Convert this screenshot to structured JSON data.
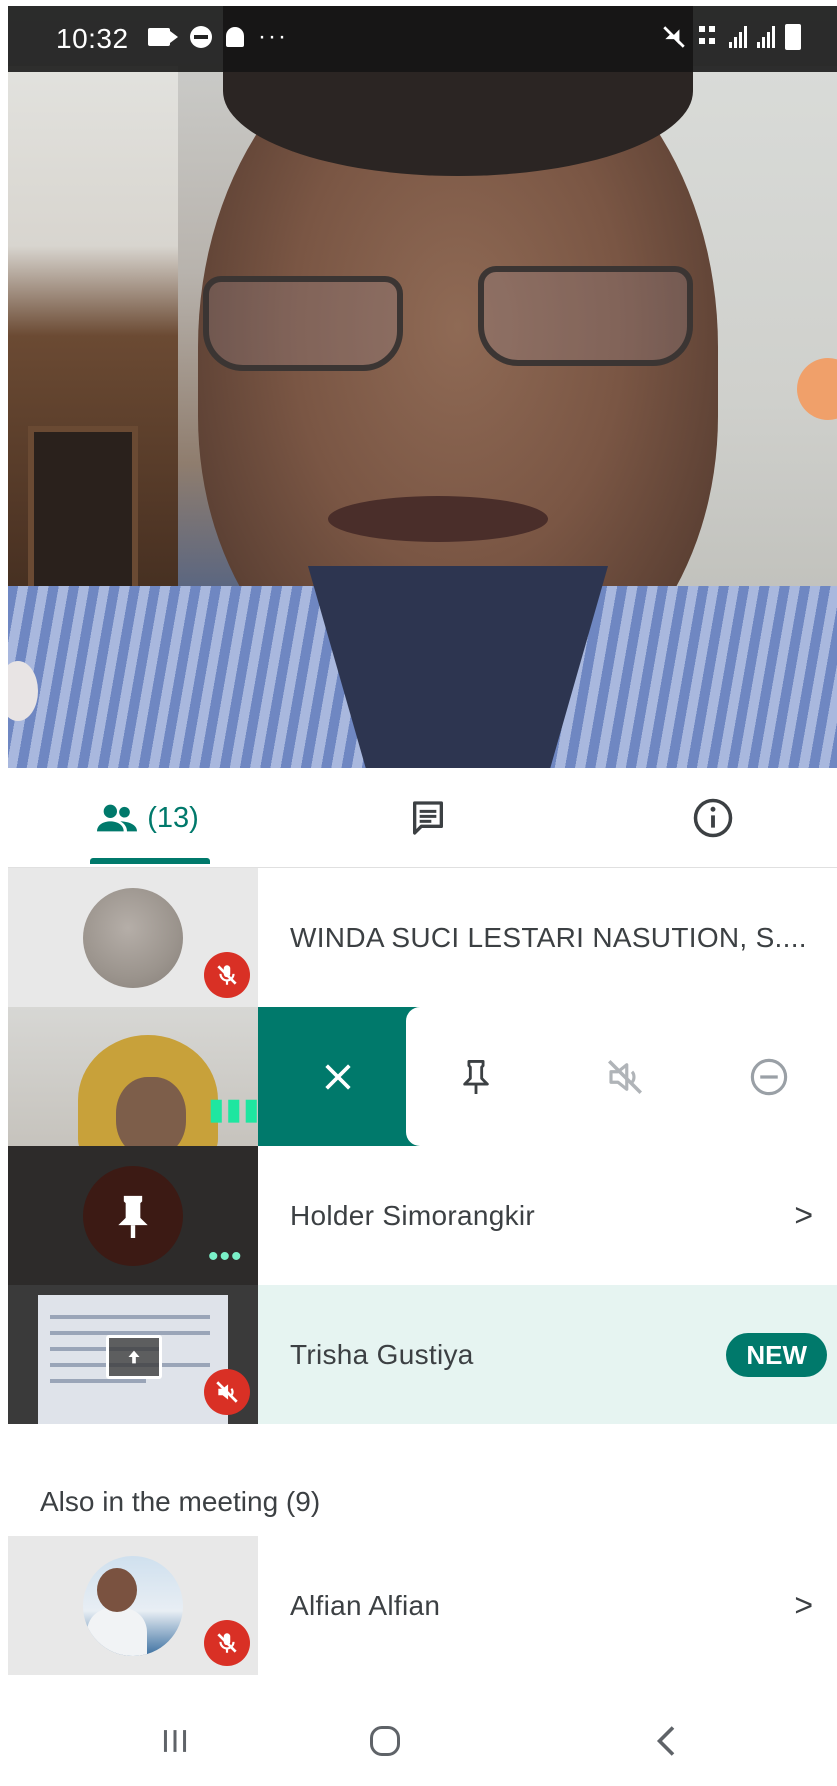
{
  "status_bar": {
    "time": "10:32",
    "left_icons": [
      "video-camera-icon",
      "dnd-icon",
      "notification-bell-icon",
      "more-dots-icon"
    ],
    "right_icons": [
      "mute-vibrate-icon",
      "wifi-calling-icon",
      "signal-sim1-icon",
      "signal-sim2-icon",
      "battery-icon"
    ]
  },
  "tabs": {
    "people": {
      "icon": "people-icon",
      "count": "(13)"
    },
    "chat": {
      "icon": "chat-icon"
    },
    "info": {
      "icon": "info-icon"
    }
  },
  "participants": [
    {
      "name": "WINDA SUCI LESTARI NASUTION, S....",
      "thumb": "grey-avatar",
      "status_icon": "mic-off-icon"
    },
    {
      "name": "",
      "thumb": "video",
      "status_icon": "audio-level-dots",
      "actions": [
        "close-icon",
        "pin-icon",
        "mute-icon",
        "remove-icon"
      ]
    },
    {
      "name": "Holder Simorangkir",
      "thumb": "pin-circle",
      "status_icon": "audio-level-dots",
      "chevron": ">"
    },
    {
      "name": "Trisha Gustiya",
      "thumb": "presentation",
      "status_icon": "volume-off-icon",
      "badge": "NEW"
    }
  ],
  "also_in_meeting": {
    "header": "Also in the meeting (9)",
    "items": [
      {
        "name": "Alfian Alfian",
        "thumb": "photo-avatar",
        "status_icon": "mic-off-icon",
        "chevron": ">"
      }
    ]
  },
  "nav_bar": {
    "icons": [
      "recents-icon",
      "home-icon",
      "back-icon"
    ]
  },
  "colors": {
    "accent": "#00796b",
    "muted_badge": "#d93025",
    "highlight_row": "#e6f4f1"
  }
}
